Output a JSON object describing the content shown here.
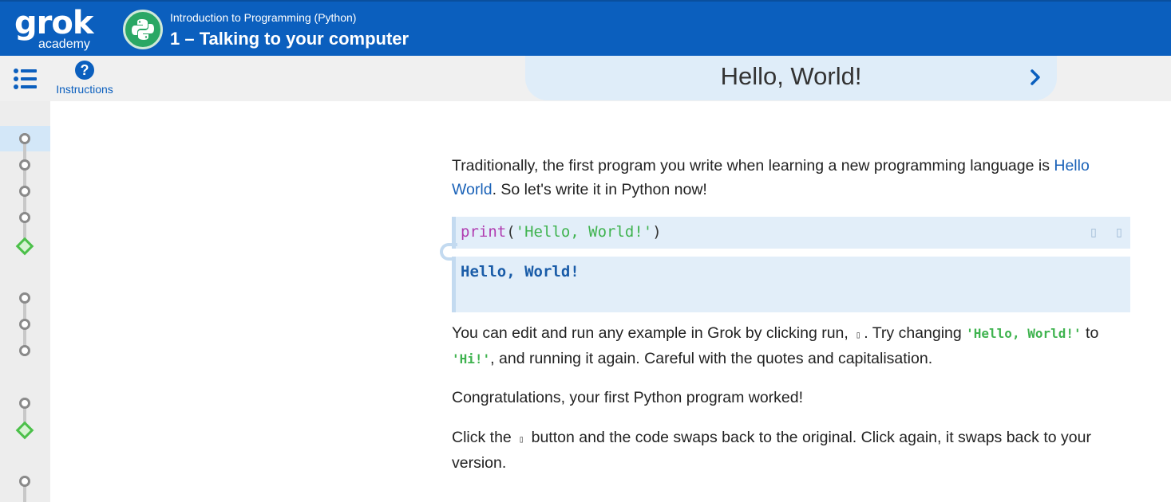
{
  "header": {
    "logo_main": "grok",
    "logo_sub": "academy",
    "course_name": "Introduction to Programming (Python)",
    "module_title": "1 – Talking to your computer"
  },
  "toolbar": {
    "instructions_label": "Instructions",
    "help_glyph": "?",
    "slide_title": "Hello, World!"
  },
  "content": {
    "p1_a": "Traditionally, the first program you write when learning a new programming language is ",
    "p1_link": "Hello World",
    "p1_b": ". So let's write it in Python now!",
    "code_kw": "print",
    "code_open": "(",
    "code_str": "'Hello, World!'",
    "code_close": ")",
    "tool_glyph_1": "▯",
    "tool_glyph_2": "▯",
    "output": "Hello, World!",
    "p2_a": "You can edit and run any example in Grok by clicking run, ",
    "p2_glyph": "▯",
    "p2_b": ". Try changing ",
    "p2_code1": "'Hello, World!'",
    "p2_c": " to ",
    "p2_code2": "'Hi!'",
    "p2_d": ", and running it again. Careful with the quotes and capitalisation.",
    "p3": "Congratulations, your first Python program worked!",
    "p4_a": "Click the ",
    "p4_glyph": "▯",
    "p4_b": " button and the code swaps back to the original. Click again, it swaps back to your version."
  },
  "colors": {
    "brand_blue": "#0b5fbe",
    "python_badge_green": "#2aa765",
    "complete_green": "#4cc04a",
    "code_keyword": "#b03cb0",
    "code_string": "#3fb34f"
  },
  "rail": {
    "nodes": [
      "circle-active",
      "circle",
      "circle",
      "circle",
      "diamond",
      "circle",
      "circle",
      "circle",
      "circle",
      "diamond",
      "circle"
    ]
  }
}
